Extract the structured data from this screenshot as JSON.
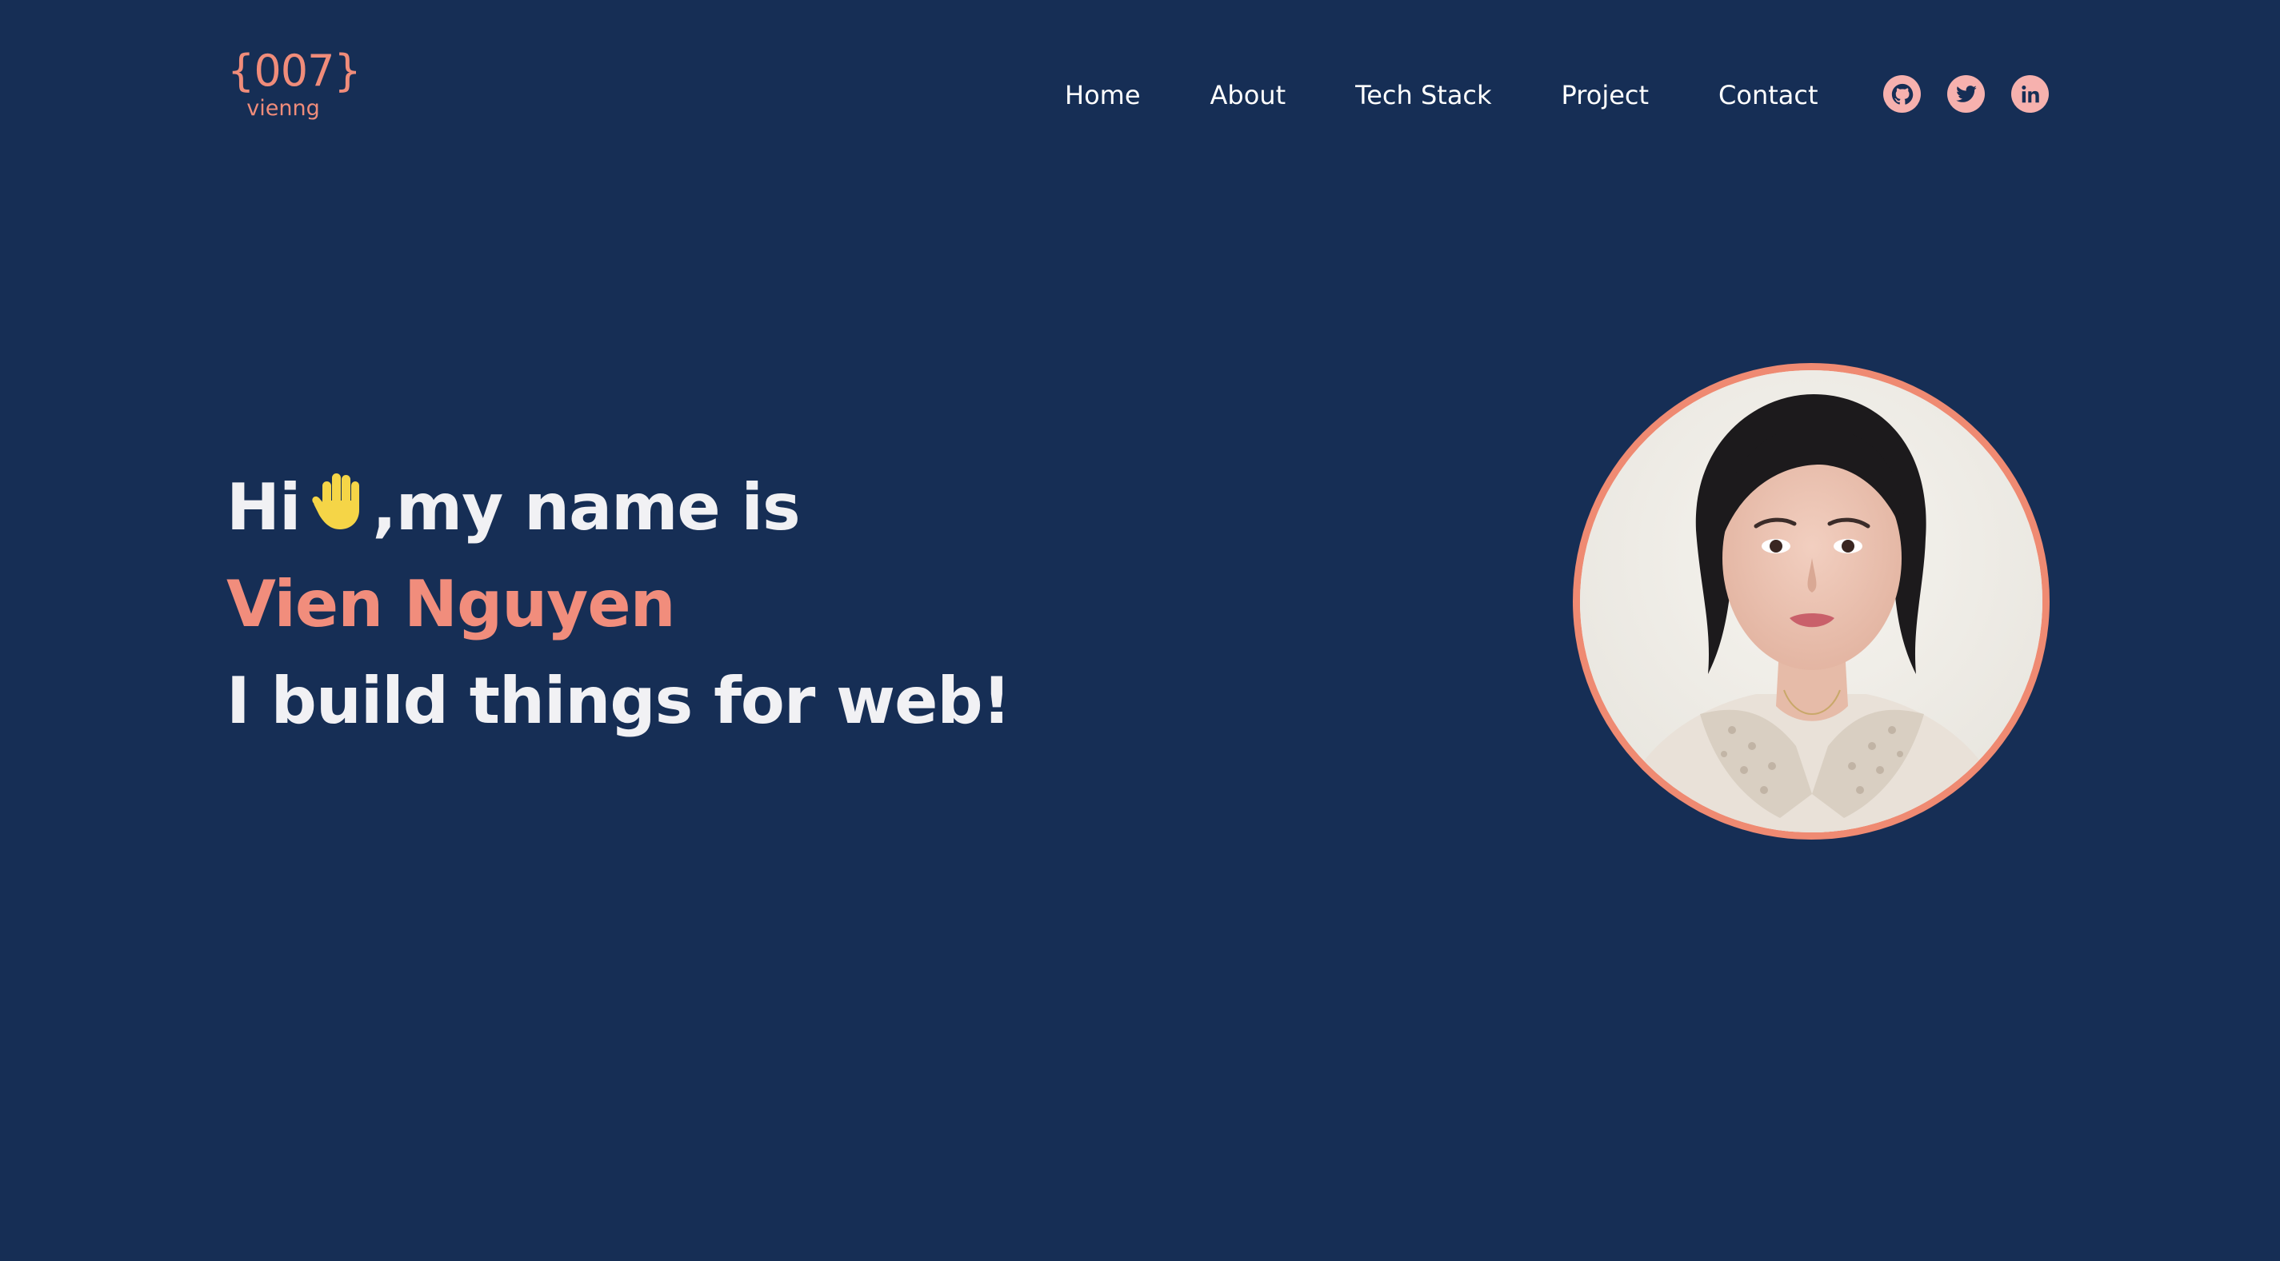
{
  "logo": {
    "mark": "{007}",
    "sub": "vienng"
  },
  "nav": {
    "items": [
      "Home",
      "About",
      "Tech Stack",
      "Project",
      "Contact"
    ]
  },
  "social": {
    "icons": [
      "github-icon",
      "twitter-icon",
      "linkedin-icon"
    ]
  },
  "hero": {
    "greeting_before": "Hi",
    "greeting_after": ",my name is",
    "name": "Vien Nguyen",
    "tagline": "I build things for web!"
  },
  "colors": {
    "background": "#162e55",
    "accent": "#f18d7c",
    "social_bg": "#f6b1ae",
    "text": "#f1f1f4",
    "wave": "#f5d547"
  }
}
